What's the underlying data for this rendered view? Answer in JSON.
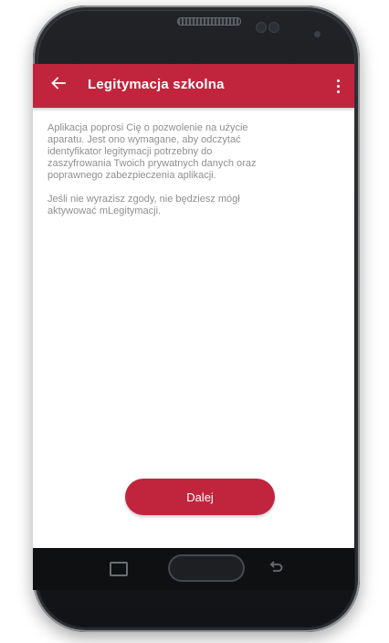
{
  "appbar": {
    "title": "Legitymacja szkolna",
    "back_icon": "arrow-left-icon",
    "menu_icon": "more-vertical-icon",
    "color": "#c1253d"
  },
  "content": {
    "paragraph1": "Aplikacja poprosi Cię o pozwolenie na użycie aparatu. Jest ono wymagane, aby odczytać identyfikator legitymacji potrzebny do zaszyfrowania Twoich prywatnych danych oraz poprawnego zabezpieczenia aplikacji.",
    "paragraph2": "Jeśli nie wyrazisz zgody, nie będziesz mógł aktywować mLegitymacji."
  },
  "button": {
    "label": "Dalej"
  },
  "navbar": {
    "recent_icon": "recent-apps-icon",
    "home_icon": "home-button-icon",
    "back_icon": "back-icon"
  }
}
